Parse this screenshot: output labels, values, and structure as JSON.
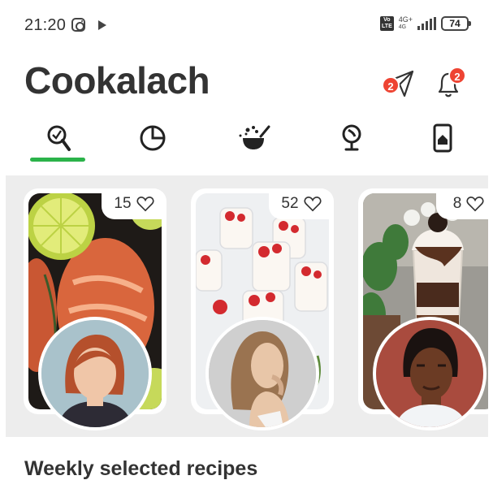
{
  "status_bar": {
    "time": "21:20",
    "network": "4G+",
    "volte": "Vo LTE",
    "battery": "74"
  },
  "header": {
    "title": "Cookalach",
    "messages_badge": "2",
    "notifications_badge": "2"
  },
  "tabs": [
    {
      "icon": "search-food-icon",
      "active": true
    },
    {
      "icon": "pie-chart-icon",
      "active": false
    },
    {
      "icon": "cooking-pot-icon",
      "active": false
    },
    {
      "icon": "globe-icon",
      "active": false
    },
    {
      "icon": "home-phone-icon",
      "active": false
    }
  ],
  "accent_color": "#2bb34a",
  "badge_color": "#ee4433",
  "stories": [
    {
      "likes": "15",
      "dish": "salmon with lime",
      "heart_icon": "heart-outline-icon"
    },
    {
      "likes": "52",
      "dish": "strawberry panna cotta",
      "heart_icon": "heart-outline-icon"
    },
    {
      "likes": "8",
      "dish": "chocolate parfait",
      "heart_icon": "heart-outline-icon"
    }
  ],
  "section": {
    "title": "Weekly selected recipes"
  }
}
